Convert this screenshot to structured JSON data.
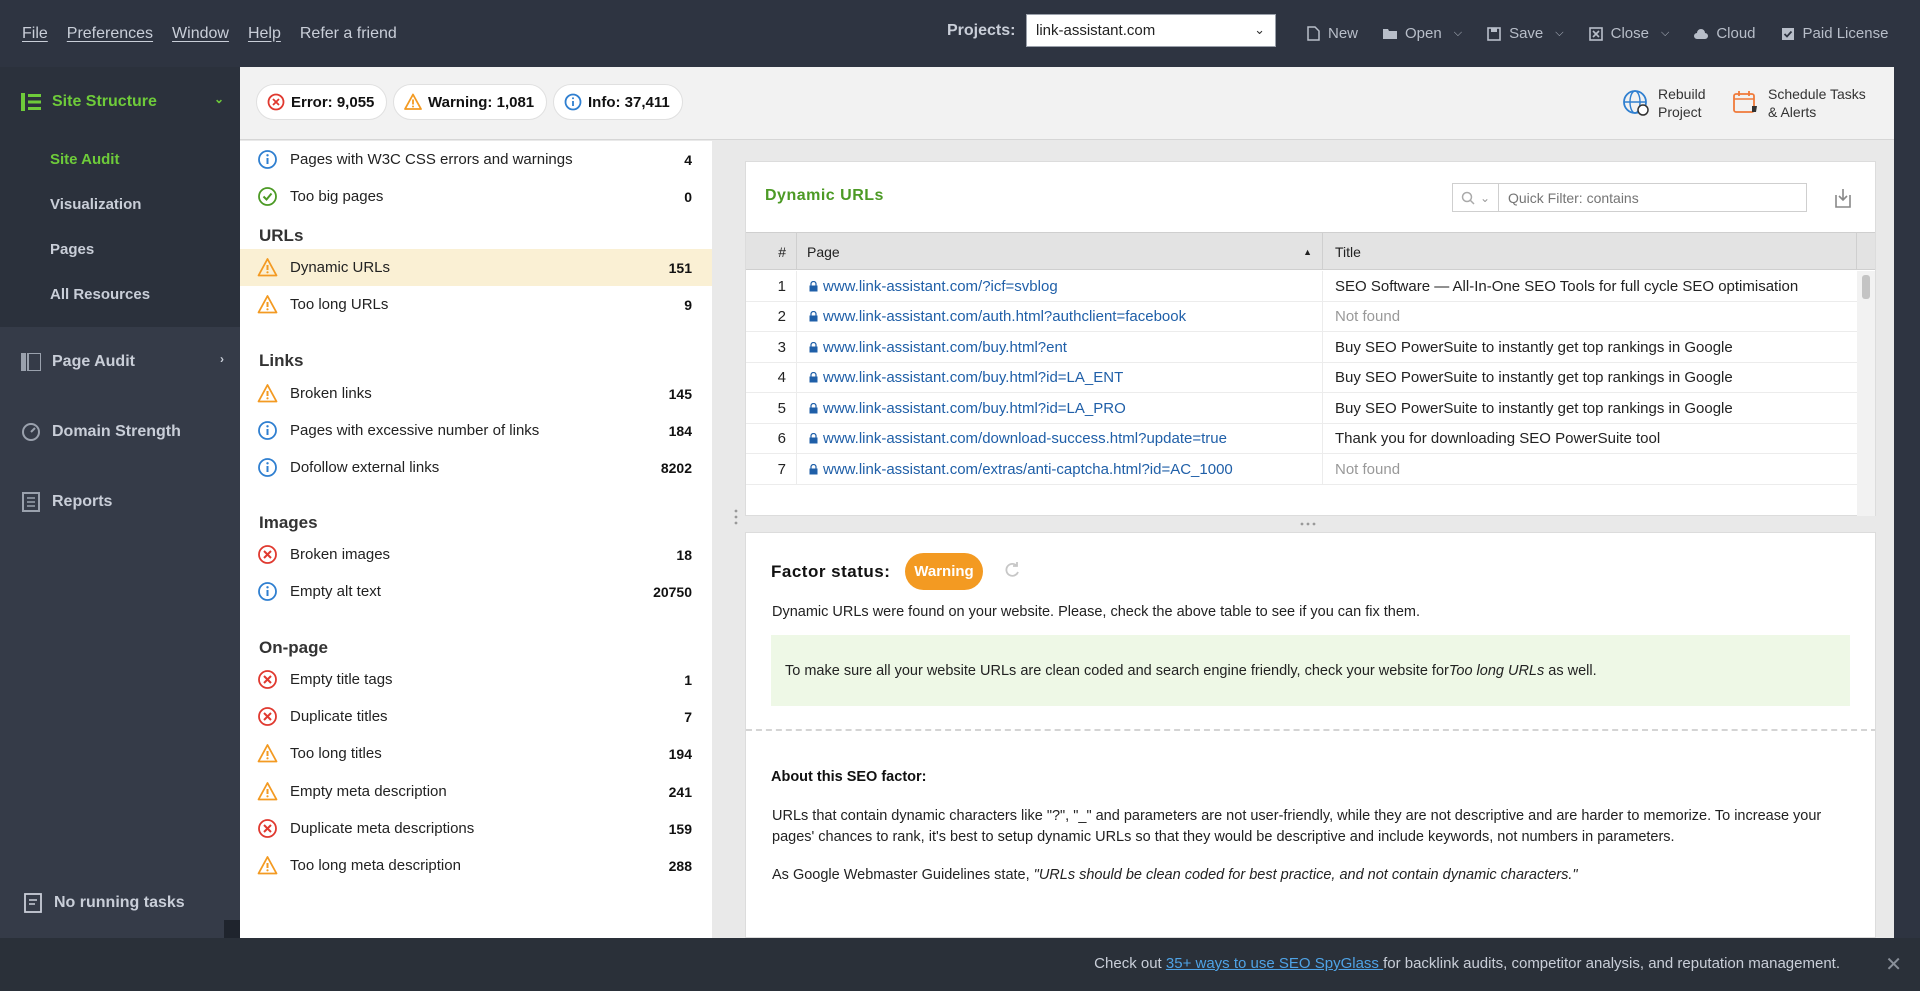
{
  "menu": {
    "items": [
      "File",
      "Preferences",
      "Window",
      "Help",
      "Refer a friend"
    ],
    "projects_label": "Projects:",
    "project_value": "link-assistant.com"
  },
  "toolbar": {
    "new": "New",
    "open": "Open",
    "save": "Save",
    "close": "Close",
    "cloud": "Cloud",
    "license": "Paid License"
  },
  "sidebar": {
    "site_structure": "Site Structure",
    "sub_items": [
      "Site Audit",
      "Visualization",
      "Pages",
      "All Resources"
    ],
    "page_audit": "Page Audit",
    "domain_strength": "Domain Strength",
    "reports": "Reports",
    "no_tasks": "No running tasks"
  },
  "status": {
    "error": "Error: 9,055",
    "warning": "Warning: 1,081",
    "info": "Info: 37,411",
    "rebuild_line1": "Rebuild",
    "rebuild_line2": "Project",
    "schedule_line1": "Schedule Tasks",
    "schedule_line2": "& Alerts"
  },
  "factors": {
    "groups": {
      "urls": "URLs",
      "links": "Links",
      "images": "Images",
      "onpage": "On-page"
    },
    "items": [
      {
        "label": "Pages with W3C CSS errors and warnings",
        "count": "4",
        "status": "info"
      },
      {
        "label": "Too big pages",
        "count": "0",
        "status": "ok"
      },
      {
        "label": "Dynamic URLs",
        "count": "151",
        "status": "warning"
      },
      {
        "label": "Too long URLs",
        "count": "9",
        "status": "warning"
      },
      {
        "label": "Broken links",
        "count": "145",
        "status": "warning"
      },
      {
        "label": "Pages with excessive number of links",
        "count": "184",
        "status": "info"
      },
      {
        "label": "Dofollow external links",
        "count": "8202",
        "status": "info"
      },
      {
        "label": "Broken images",
        "count": "18",
        "status": "error"
      },
      {
        "label": "Empty alt text",
        "count": "20750",
        "status": "info"
      },
      {
        "label": "Empty title tags",
        "count": "1",
        "status": "error"
      },
      {
        "label": "Duplicate titles",
        "count": "7",
        "status": "error"
      },
      {
        "label": "Too long titles",
        "count": "194",
        "status": "warning"
      },
      {
        "label": "Empty meta description",
        "count": "241",
        "status": "warning"
      },
      {
        "label": "Duplicate meta descriptions",
        "count": "159",
        "status": "error"
      },
      {
        "label": "Too long meta description",
        "count": "288",
        "status": "warning"
      }
    ]
  },
  "table": {
    "title": "Dynamic URLs",
    "filter_placeholder": "Quick Filter: contains",
    "columns": [
      "#",
      "Page",
      "Title"
    ],
    "rows": [
      {
        "n": "1",
        "page": "www.link-assistant.com/?icf=svblog",
        "title": "SEO Software — All-In-One SEO Tools for full cycle SEO optimisation",
        "nf": false
      },
      {
        "n": "2",
        "page": "www.link-assistant.com/auth.html?authclient=facebook",
        "title": "Not found",
        "nf": true
      },
      {
        "n": "3",
        "page": "www.link-assistant.com/buy.html?ent",
        "title": "Buy SEO PowerSuite to instantly get top rankings in Google",
        "nf": false
      },
      {
        "n": "4",
        "page": "www.link-assistant.com/buy.html?id=LA_ENT",
        "title": "Buy SEO PowerSuite to instantly get top rankings in Google",
        "nf": false
      },
      {
        "n": "5",
        "page": "www.link-assistant.com/buy.html?id=LA_PRO",
        "title": "Buy SEO PowerSuite to instantly get top rankings in Google",
        "nf": false
      },
      {
        "n": "6",
        "page": "www.link-assistant.com/download-success.html?update=true",
        "title": "Thank you for downloading SEO PowerSuite tool",
        "nf": false
      },
      {
        "n": "7",
        "page": "www.link-assistant.com/extras/anti-captcha.html?id=AC_1000",
        "title": "Not found",
        "nf": true
      }
    ]
  },
  "factor_info": {
    "status_label": "Factor status:",
    "status_value": "Warning",
    "description": "Dynamic URLs were found on your website. Please, check the above table to see if you can fix them.",
    "tip_before": "To make sure all your website URLs are clean coded and search engine friendly, check your website for ",
    "tip_em": "Too long URLs",
    "tip_after": " as well.",
    "about_title": "About this SEO factor:",
    "about_p1": "URLs that contain dynamic characters like \"?\", \"_\" and parameters are not user-friendly, while they are not descriptive and are harder to memorize. To increase your pages' chances to rank, it's best to setup dynamic URLs so that they would be descriptive and include keywords, not numbers in parameters.",
    "about_p2_before": "As Google Webmaster Guidelines state, ",
    "about_p2_quote": "\"URLs should be clean coded for best practice, and not contain dynamic characters.\""
  },
  "notification": {
    "before": "Check out ",
    "link": "35+ ways to use SEO SpyGlass ",
    "after": "for backlink audits, competitor analysis, and reputation management."
  },
  "colors": {
    "accent_green": "#6ecb3a",
    "warning_orange": "#f39a22",
    "error_red": "#e0392f",
    "info_blue": "#2f7fd0",
    "link_blue": "#1f5fa8"
  }
}
